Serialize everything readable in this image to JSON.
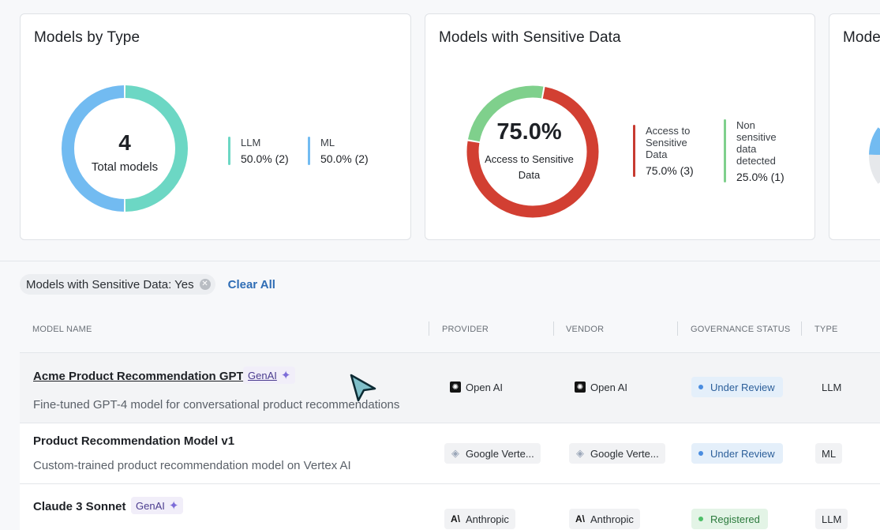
{
  "cards": [
    {
      "title": "Models by Type",
      "center_value": "4",
      "center_label": "Total models",
      "chart_data": {
        "type": "pie",
        "title": "Models by Type",
        "categories": [
          "LLM",
          "ML"
        ],
        "values": [
          2,
          2
        ],
        "percent_labels": [
          "50.0% (2)",
          "50.0% (2)"
        ],
        "colors": [
          "#6cd7c4",
          "#72bbf1"
        ]
      },
      "legend": [
        {
          "label": "LLM",
          "value": "50.0% (2)",
          "color": "#6cd7c4"
        },
        {
          "label": "ML",
          "value": "50.0% (2)",
          "color": "#72bbf1"
        }
      ]
    },
    {
      "title": "Models with Sensitive Data",
      "center_value": "75.0%",
      "center_label_line1": "Access to Sensitive",
      "center_label_line2": "Data",
      "chart_data": {
        "type": "pie",
        "title": "Models with Sensitive Data",
        "categories": [
          "Access to Sensitive Data",
          "Non sensitive data detected"
        ],
        "values": [
          3,
          1
        ],
        "percent_labels": [
          "75.0% (3)",
          "25.0% (1)"
        ],
        "colors": [
          "#d23f32",
          "#7fd08c"
        ]
      },
      "legend": [
        {
          "label_lines": [
            "Access to",
            "Sensitive",
            "Data"
          ],
          "value": "75.0% (3)",
          "color": "#c73b31"
        },
        {
          "label_lines": [
            "Non",
            "sensitive",
            "data",
            "detected"
          ],
          "value": "25.0% (1)",
          "color": "#7fd08c"
        }
      ]
    },
    {
      "title": "Mode"
    }
  ],
  "filters": {
    "chip_label": "Models with Sensitive Data: Yes",
    "clear_all": "Clear All"
  },
  "table": {
    "headers": [
      "MODEL NAME",
      "PROVIDER",
      "VENDOR",
      "GOVERNANCE STATUS",
      "TYPE"
    ],
    "rows": [
      {
        "name": "Acme Product Recommendation GPT",
        "badge": "GenAI",
        "description": "Fine-tuned GPT-4 model for conversational product recommendations",
        "provider": "Open AI",
        "vendor": "Open AI",
        "status": "Under Review",
        "type": "LLM"
      },
      {
        "name": "Product Recommendation Model v1",
        "badge": "",
        "description": "Custom-trained product recommendation model on Vertex AI",
        "provider": "Google Verte...",
        "vendor": "Google Verte...",
        "status": "Under Review",
        "type": "ML"
      },
      {
        "name": "Claude 3 Sonnet",
        "badge": "GenAI",
        "description": "",
        "provider": "Anthropic",
        "vendor": "Anthropic",
        "status": "Registered",
        "type": "LLM"
      }
    ]
  }
}
